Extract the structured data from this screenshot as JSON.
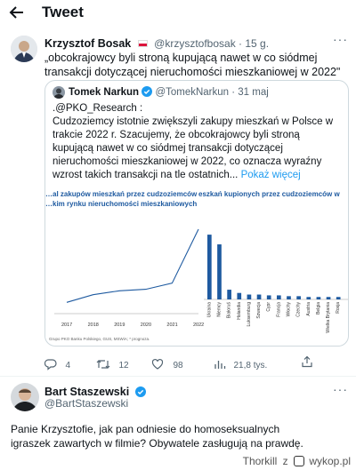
{
  "header": {
    "title": "Tweet"
  },
  "main_tweet": {
    "author_name": "Krzysztof Bosak",
    "handle_time": "@krzysztofbosak · 15 g.",
    "text": "„obcokrajowcy byli stroną kupującą nawet w co siódmej transakcji dotyczącej nieruchomości mieszkaniowej w 2022\"",
    "quote": {
      "author_name": "Tomek Narkun",
      "handle_time": "@TomekNarkun · 31 maj",
      "source": ".@PKO_Research :",
      "text": "Cudzoziemcy istotnie zwiększyli zakupy mieszkań w Polsce w trakcie 2022 r.  Szacujemy, że obcokrajowcy byli stroną kupującą nawet w co siódmej transakcji dotyczącej nieruchomości mieszkaniowej w 2022, co oznacza wyraźny wzrost takich transakcji na tle ostatnich...",
      "more_link": "Pokaż więcej"
    },
    "actions": {
      "replies": "4",
      "retweets": "12",
      "likes": "98",
      "views": "21,8 tys."
    }
  },
  "reply": {
    "author_name": "Bart Staszewski",
    "handle": "@BartStaszewski",
    "text": "Panie Krzysztofie, jak pan odniesie do homoseksualnych igraszek zawartych w filmie? Obywatele zasługują na prawdę."
  },
  "footer": {
    "user": "Thorkill",
    "sep": "z",
    "site": "wykop.pl"
  },
  "colors": {
    "accent": "#1d9bf0",
    "chart_blue": "#1e5aa0",
    "verified": "#1d9bf0"
  },
  "chart_data": [
    {
      "type": "line",
      "title": "…al  zakupów  mieszkań  przez  cudzoziemców",
      "subtitle": "…kim rynku nieruchomości mieszkaniowych",
      "x": [
        "2017",
        "2018",
        "2019",
        "2020",
        "2021",
        "2022"
      ],
      "values": [
        1.0,
        2.0,
        2.5,
        2.7,
        3.5,
        10.5
      ],
      "ylim": [
        0,
        12
      ],
      "source_note": "Grupo PKO Banku Polskiego, GUS, MSWiA; * prognoza.",
      "grid": false
    },
    {
      "type": "bar",
      "title": "eszkań kupionych przez cudzoziemców w",
      "categories": [
        "Ukraina",
        "Niemcy",
        "Białoruś",
        "Holandia",
        "Luksemburg",
        "Szwecja",
        "Cypr",
        "Francja",
        "Włochy",
        "Czechy",
        "Austria",
        "Belgia",
        "Wielka Brytania",
        "Rosja"
      ],
      "values": [
        40,
        34,
        6,
        4,
        3,
        3,
        2.5,
        2.5,
        2,
        2,
        1.5,
        1.5,
        1.5,
        1.5
      ],
      "ylim": [
        0,
        45
      ],
      "grid": false
    }
  ]
}
